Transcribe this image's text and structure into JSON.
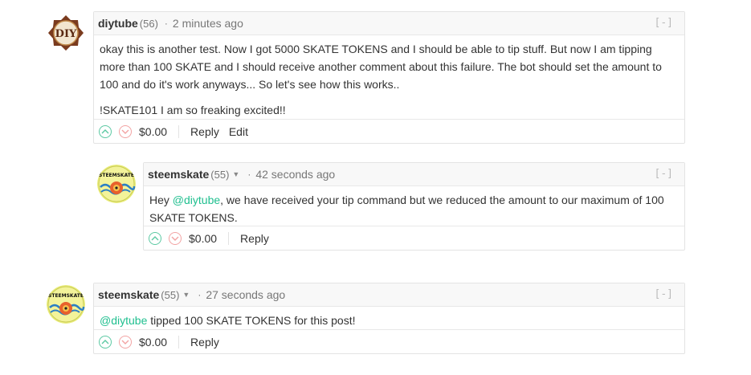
{
  "comments": [
    {
      "author": "diytube",
      "reputation": "(56)",
      "dot": "·",
      "time": "2 minutes ago",
      "collapse": "[-]",
      "paragraph1": "okay this is another test. Now I got 5000 SKATE TOKENS and I should be able to tip stuff. But now I am tipping more than 100 SKATE and I should receive another comment about this failure. The bot should set the amount to 100 and do it's work anyways... So let's see how this works..",
      "paragraph2": "!SKATE101 I am so freaking excited!!",
      "avatar_text": "DIY",
      "payout": "$0.00",
      "reply_label": "Reply",
      "edit_label": "Edit"
    },
    {
      "author": "steemskate",
      "reputation": "(55)",
      "dot": "·",
      "time": "42 seconds ago",
      "collapse": "[-]",
      "body_before": "Hey ",
      "mention": "@diytube",
      "body_after": ", we have received your tip command but we reduced the amount to our maximum of 100 SKATE TOKENS.",
      "avatar_text": "STEEMSKATE",
      "payout": "$0.00",
      "reply_label": "Reply"
    },
    {
      "author": "steemskate",
      "reputation": "(55)",
      "dot": "·",
      "time": "27 seconds ago",
      "collapse": "[-]",
      "mention": "@diytube",
      "body_after": " tipped 100 SKATE TOKENS for this post!",
      "avatar_text": "STEEMSKATE",
      "payout": "$0.00",
      "reply_label": "Reply"
    }
  ],
  "colors": {
    "accent": "#1fbf8f",
    "upvote": "#5cc9a3",
    "downvote": "#f2a3a3",
    "diy_logo": "#7a3b1e"
  },
  "icons": {
    "upvote": "chevron-up-icon",
    "downvote": "chevron-down-icon",
    "user_menu": "caret-down-icon"
  }
}
